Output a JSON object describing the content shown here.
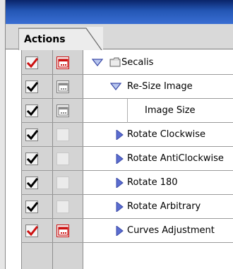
{
  "panel": {
    "tab_label": "Actions"
  },
  "rows": [
    {
      "label": "Secalis",
      "checked": true,
      "check_color": "#cc1111",
      "dialog": "red",
      "expand": "expanded",
      "kind": "set"
    },
    {
      "label": "Re-Size Image",
      "checked": true,
      "check_color": "#000000",
      "dialog": "gray",
      "expand": "expanded",
      "kind": "action"
    },
    {
      "label": "Image Size",
      "checked": true,
      "check_color": "#000000",
      "dialog": "gray",
      "expand": "none",
      "kind": "step"
    },
    {
      "label": "Rotate Clockwise",
      "checked": true,
      "check_color": "#000000",
      "dialog": "empty",
      "expand": "collapsed",
      "kind": "action"
    },
    {
      "label": "Rotate AntiClockwise",
      "checked": true,
      "check_color": "#000000",
      "dialog": "empty",
      "expand": "collapsed",
      "kind": "action"
    },
    {
      "label": "Rotate 180",
      "checked": true,
      "check_color": "#000000",
      "dialog": "empty",
      "expand": "collapsed",
      "kind": "action"
    },
    {
      "label": "Rotate Arbitrary",
      "checked": true,
      "check_color": "#000000",
      "dialog": "empty",
      "expand": "collapsed",
      "kind": "action"
    },
    {
      "label": "Curves Adjustment",
      "checked": true,
      "check_color": "#cc1111",
      "dialog": "red",
      "expand": "collapsed",
      "kind": "action"
    }
  ],
  "colors": {
    "title_bar": "#2457b5",
    "check_black": "#000000",
    "check_red": "#cc1111",
    "dialog_red": "#cc1111",
    "triangle": "#3b4aa8"
  }
}
